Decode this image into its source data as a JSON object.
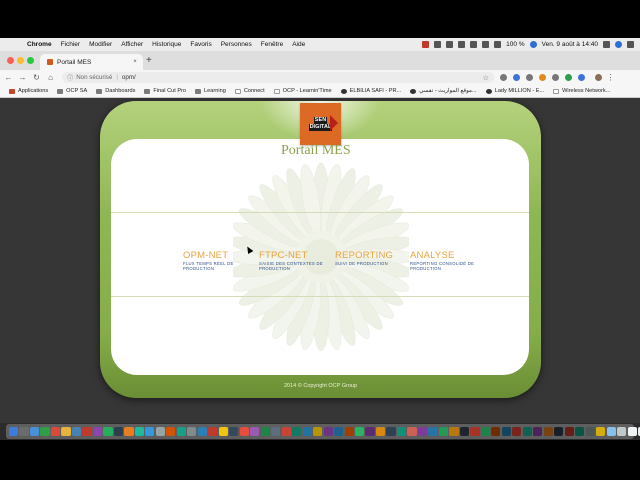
{
  "menubar": {
    "apple_glyph": "",
    "items": [
      "Chrome",
      "Fichier",
      "Modifier",
      "Afficher",
      "Historique",
      "Favoris",
      "Personnes",
      "Fenêtre",
      "Aide"
    ],
    "battery": "100 %",
    "datetime": "Ven. 9 août à 14:40"
  },
  "browser": {
    "tab_title": "Portail MES",
    "tab_close": "×",
    "new_tab": "+",
    "back": "←",
    "forward": "→",
    "reload": "↻",
    "home": "⌂",
    "security_text": "Non sécurisé",
    "url": "opm/",
    "bookmark_star": "☆"
  },
  "bookmarks": [
    {
      "label": "Applications",
      "icon": "apps-grid-icon"
    },
    {
      "label": "OCP SA",
      "icon": "folder-icon"
    },
    {
      "label": "Dashboards",
      "icon": "folder-icon"
    },
    {
      "label": "Final Cut Pro",
      "icon": "folder-icon"
    },
    {
      "label": "Learning",
      "icon": "folder-icon"
    },
    {
      "label": "Connect",
      "icon": "page-icon"
    },
    {
      "label": "OCP - Learnin'Time",
      "icon": "page-icon"
    },
    {
      "label": "ELBILIA SAFI - PR...",
      "icon": "site-icon"
    },
    {
      "label": "موقع المواريث - تقسي...",
      "icon": "site-icon"
    },
    {
      "label": "Lady MILLION - E...",
      "icon": "site-icon"
    },
    {
      "label": "Wireless Network...",
      "icon": "page-icon"
    }
  ],
  "page": {
    "logo_text_top": "SEN",
    "logo_text_main": "DIGITAL",
    "title": "Portail MES",
    "modules": [
      {
        "name": "OPM-NET",
        "desc": "FLUX TEMPS RÉEL DE PRODUCTION"
      },
      {
        "name": "FTPC-NET",
        "desc": "SAISIE DES CONTEXTES DE PRODUCTION"
      },
      {
        "name": "REPORTING",
        "desc": "SUIVI DE PRODUCTION"
      },
      {
        "name": "ANALYSE",
        "desc": "REPORTING CONSOLIDÉ DE PRODUCTION"
      }
    ],
    "copyright": "2014 © Copyright OCP Group"
  },
  "colors": {
    "frame_green": "#8fb655",
    "module_orange": "#e8a440",
    "module_desc_blue": "#2b4f8c",
    "title_green": "#8ca04c",
    "logo_orange": "#dd6a24"
  },
  "dock": {
    "app_colors": [
      "#3b7dd8",
      "#6c6c6c",
      "#4a90d9",
      "#2f9e44",
      "#d94a3b",
      "#e8b33a",
      "#4682b4",
      "#c0392b",
      "#8e44ad",
      "#27ae60",
      "#2c3e50",
      "#e67e22",
      "#1abc9c",
      "#3498db",
      "#95a5a6",
      "#d35400",
      "#16a085",
      "#7f8c8d",
      "#2980b9",
      "#c0392b",
      "#f1c40f",
      "#34495e",
      "#e74c3c",
      "#9b59b6",
      "#1e8449",
      "#5d6d7e",
      "#cb4335",
      "#117a65",
      "#2471a3",
      "#b7950b",
      "#6c3483",
      "#1f618d",
      "#a04000",
      "#28b463",
      "#5b2c6f",
      "#d68910",
      "#2e4053",
      "#148f77",
      "#cd6155",
      "#7d3c98",
      "#2874a6",
      "#239b56",
      "#b9770e",
      "#1b2631",
      "#a93226",
      "#1d8348",
      "#6e2c00",
      "#154360",
      "#7b241c",
      "#0e6251",
      "#4a235a",
      "#784212",
      "#17202a",
      "#641e16",
      "#0b5345",
      "#4d5656",
      "#d4ac0d",
      "#85c1e9",
      "#bfc9ca",
      "#f0f3f4",
      "#eaeded"
    ]
  }
}
